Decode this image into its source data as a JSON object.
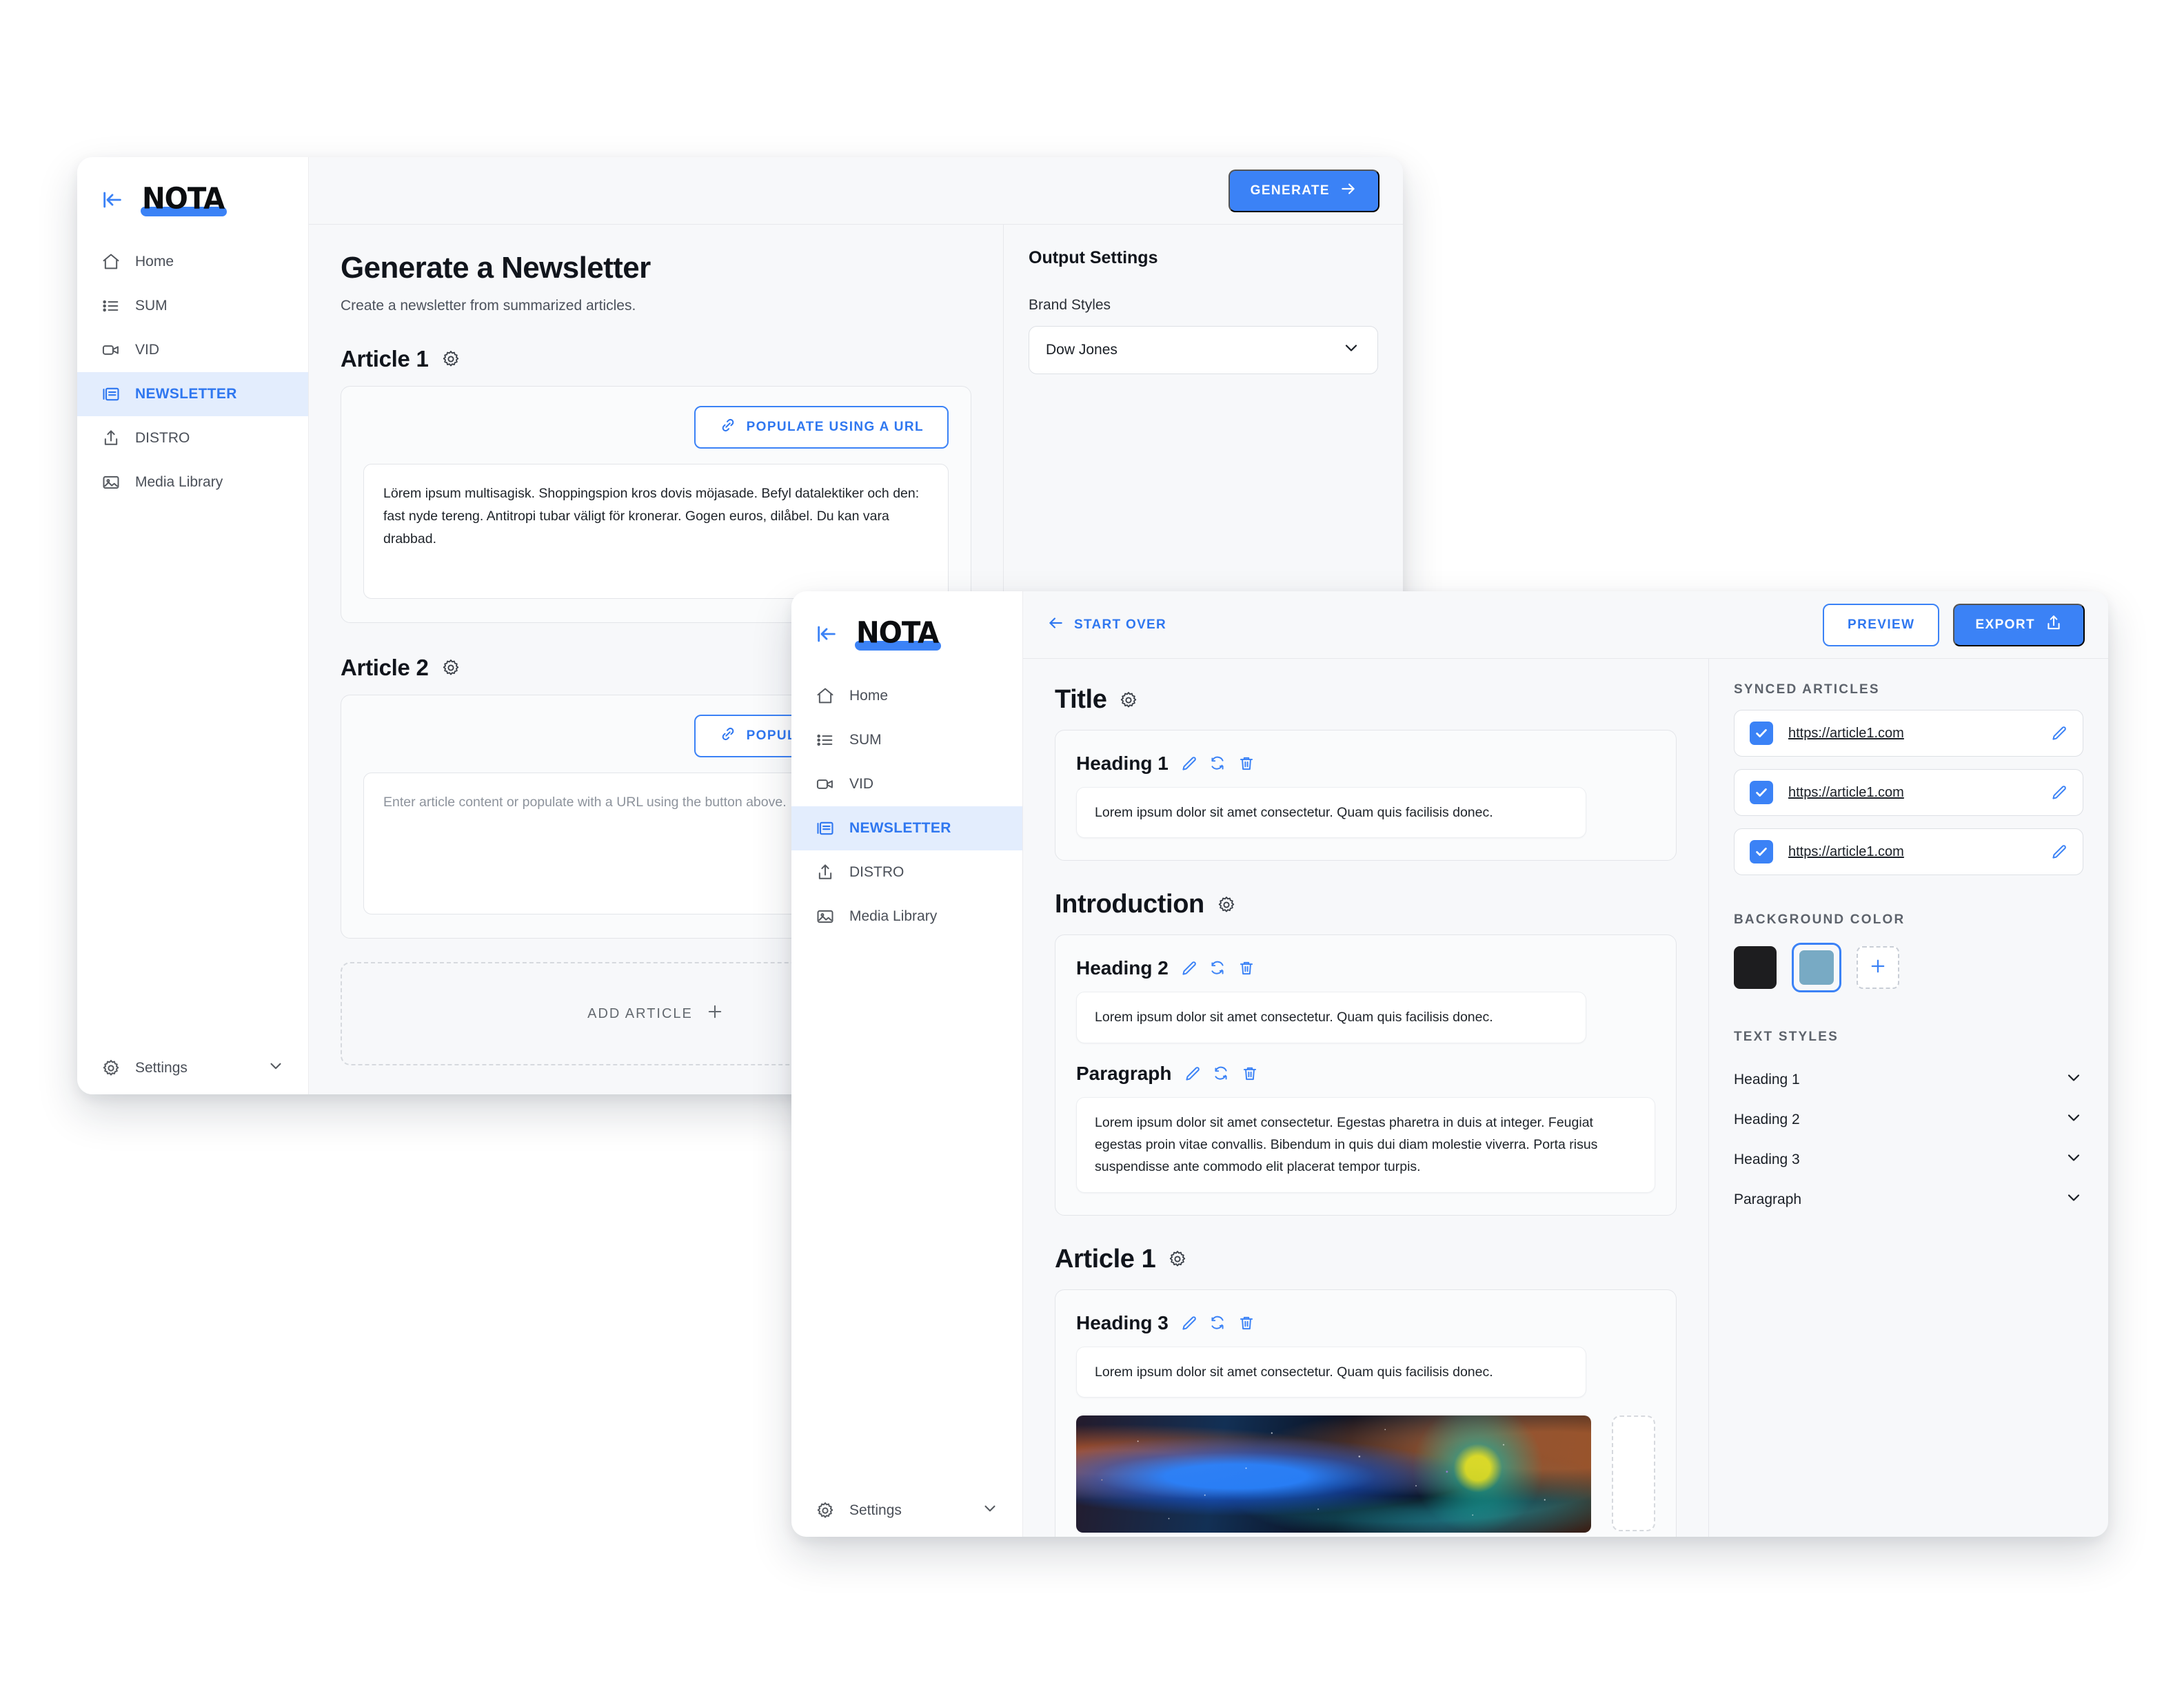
{
  "brand": {
    "name": "NOTA",
    "accent": "#3b82f6"
  },
  "sidebar": {
    "collapse_icon": "collapse-left-icon",
    "items": [
      {
        "label": "Home",
        "icon": "home-icon",
        "active": false
      },
      {
        "label": "SUM",
        "icon": "list-icon",
        "active": false
      },
      {
        "label": "VID",
        "icon": "video-icon",
        "active": false
      },
      {
        "label": "NEWSLETTER",
        "icon": "newspaper-icon",
        "active": true
      },
      {
        "label": "DISTRO",
        "icon": "share-icon",
        "active": false
      },
      {
        "label": "Media Library",
        "icon": "image-icon",
        "active": false
      }
    ],
    "settings_label": "Settings",
    "settings_icon": "gear-icon"
  },
  "back_window": {
    "topbar": {
      "generate_label": "GENERATE"
    },
    "main": {
      "title": "Generate a Newsletter",
      "subtitle": "Create a newsletter from summarized articles.",
      "articles": [
        {
          "heading": "Article 1",
          "populate_label": "POPULATE USING A URL",
          "content": "Lörem ipsum multisagisk. Shoppingspion kros dovis möjasade. Befyl datalektiker och den: fast nyde tereng. Antitropi tubar väligt för kronerar. Gogen euros, dilåbel. Du kan vara drabbad.",
          "is_placeholder": false
        },
        {
          "heading": "Article 2",
          "populate_label": "POPULATE USING A URL",
          "content": "Enter article content or populate with a URL using the button above.",
          "is_placeholder": true
        }
      ],
      "add_article_label": "ADD ARTICLE"
    },
    "side": {
      "title": "Output Settings",
      "brand_styles_label": "Brand Styles",
      "brand_styles_value": "Dow Jones"
    }
  },
  "front_window": {
    "topbar": {
      "start_over_label": "START OVER",
      "preview_label": "PREVIEW",
      "export_label": "EXPORT"
    },
    "document": {
      "sections": [
        {
          "heading": "Title",
          "blocks": [
            {
              "label": "Heading 1",
              "text": "Lorem ipsum dolor sit amet consectetur. Quam quis facilisis donec.",
              "width": "short"
            }
          ]
        },
        {
          "heading": "Introduction",
          "blocks": [
            {
              "label": "Heading 2",
              "text": "Lorem ipsum dolor sit amet consectetur. Quam quis facilisis donec.",
              "width": "short"
            },
            {
              "label": "Paragraph",
              "text": "Lorem ipsum dolor sit amet consectetur. Egestas pharetra in duis at integer. Feugiat egestas proin vitae convallis. Bibendum in quis dui diam molestie viverra. Porta risus suspendisse ante commodo elit placerat tempor turpis.",
              "width": "long"
            }
          ]
        },
        {
          "heading": "Article 1",
          "blocks": [
            {
              "label": "Heading 3",
              "text": "Lorem ipsum dolor sit amet consectetur. Quam quis facilisis donec.",
              "width": "short"
            }
          ],
          "media": {
            "alt": "nebula-image"
          }
        }
      ],
      "block_actions": [
        "edit-icon",
        "regenerate-icon",
        "delete-icon"
      ]
    },
    "side": {
      "synced_articles_label": "SYNCED ARTICLES",
      "synced_articles": [
        {
          "url": "https://article1.com",
          "checked": true
        },
        {
          "url": "https://article1.com",
          "checked": true
        },
        {
          "url": "https://article1.com",
          "checked": true
        }
      ],
      "background_color_label": "BACKGROUND COLOR",
      "background_colors": [
        {
          "hex": "#1d1d1f",
          "selected": false
        },
        {
          "hex": "#78aac4",
          "selected": true
        }
      ],
      "add_color_label": "+",
      "text_styles_label": "TEXT STYLES",
      "text_styles": [
        "Heading 1",
        "Heading 2",
        "Heading 3",
        "Paragraph"
      ]
    }
  }
}
